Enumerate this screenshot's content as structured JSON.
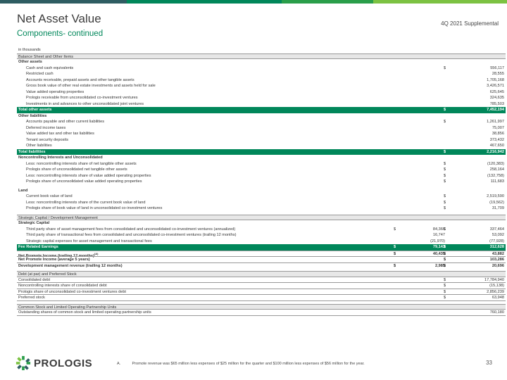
{
  "brand": {
    "colors": [
      "#2f5d62",
      "#00875a",
      "#2a9e4a",
      "#7cc242"
    ],
    "accent": "#00875a",
    "name": "PROLOGIS"
  },
  "header": {
    "title": "Net Asset Value",
    "subtitle": "Components- continued",
    "report": "4Q 2021 Supplemental"
  },
  "rows": [
    {
      "type": "plain",
      "label": "in thousands"
    },
    {
      "type": "header",
      "label": "Balance Sheet and Other Items"
    },
    {
      "type": "group",
      "label": "Other assets"
    },
    {
      "label": "Cash and cash equivalents",
      "c2d": "$",
      "c2": "556,117"
    },
    {
      "label": "Restricted cash",
      "c2": "28,555"
    },
    {
      "label": "Accounts receivable, prepaid assets and other tangible assets",
      "c2": "1,705,168"
    },
    {
      "label": "Gross book value of other real estate investments and assets held for sale",
      "c2": "3,426,571"
    },
    {
      "label": "Value added operating properties",
      "c2": "625,645"
    },
    {
      "label": "Prologis receivable from unconsolidated co-investment ventures",
      "c2": "324,635"
    },
    {
      "label": "Investments in and advances to other unconsolidated joint ventures",
      "c2": "785,503"
    },
    {
      "type": "total",
      "label": "Total other assets",
      "c2d": "$",
      "c2": "7,452,194"
    },
    {
      "type": "group",
      "label": "Other liabilities"
    },
    {
      "label": "Accounts payable and other current liabilities",
      "c2d": "$",
      "c2": "1,261,997"
    },
    {
      "label": "Deferred income taxes",
      "c2": "75,007"
    },
    {
      "label": "Value added tax and other tax liabilities",
      "c2": "38,856"
    },
    {
      "label": "Tenant security deposits",
      "c2": "373,432"
    },
    {
      "label": "Other liabilities",
      "c2": "467,650"
    },
    {
      "type": "total",
      "label": "Total liabilities",
      "c2d": "$",
      "c2": "2,216,942"
    },
    {
      "type": "group",
      "label": "Noncontrolling Interests and Unconsolidated"
    },
    {
      "label": "Less: noncontrolling interests share of net tangible other assets",
      "c2d": "$",
      "c2": "(120,383)"
    },
    {
      "label": "Prologis share of unconsolidated net tangible other assets",
      "c2d": "$",
      "c2": "258,164"
    },
    {
      "label": "Less: noncontrolling interests share of value added operating properties",
      "c2d": "$",
      "c2": "(132,758)"
    },
    {
      "label": "Prologis share of unconsolidated value added operating properties",
      "c2d": "$",
      "c2": "111,683"
    },
    {
      "type": "spacer"
    },
    {
      "type": "group",
      "label": "Land"
    },
    {
      "label": "Current book value of land",
      "c2d": "$",
      "c2": "2,519,590"
    },
    {
      "label": "Less: noncontrolling interests share of the current book value of land",
      "c2d": "$",
      "c2": "(19,562)"
    },
    {
      "label": "Prologis share of book value of land in unconsolidated co-investment ventures",
      "c2d": "$",
      "c2": "31,709"
    },
    {
      "type": "spacer"
    },
    {
      "type": "header",
      "label": "Strategic Capital / Development Management"
    },
    {
      "type": "group",
      "label": "Strategic Capital"
    },
    {
      "label": "Third party share of asset management fees from consolidated and unconsolidated co-investment ventures (annualized)",
      "c1d": "$",
      "c1": "84,366",
      "c2d": "$",
      "c2": "337,464"
    },
    {
      "label": "Third party share of transactional fees from consolidated and unconsolidated co-investment ventures (trailing 12 months)",
      "c1": "16,747",
      "c2": "53,092"
    },
    {
      "label": "Strategic capital expenses for asset management and transactional fees",
      "c1": "(21,970)",
      "c2": "(77,928)"
    },
    {
      "type": "total",
      "label": "Fee Related Earnings",
      "c1d": "$",
      "c1": "79,143",
      "c2d": "$",
      "c2": "312,628"
    },
    {
      "type": "bold",
      "label": "Net Promote Income (trailing 12 months)",
      "sup": "(A)",
      "c1d": "$",
      "c1": "40,435",
      "c2d": "$",
      "c2": "43,882"
    },
    {
      "type": "bold",
      "label": "Net Promote Income (average 5 years)",
      "c2d": "$",
      "c2": "103,286"
    },
    {
      "type": "bold",
      "label": "Development management revenue (trailing 12 months)",
      "c1d": "$",
      "c1": "2,985",
      "c2d": "$",
      "c2": "20,696"
    },
    {
      "type": "spacer"
    },
    {
      "type": "header",
      "label": "Debt (at par) and Preferred Stock"
    },
    {
      "type": "plain",
      "label": "Consolidated debt",
      "c2d": "$",
      "c2": "17,784,940"
    },
    {
      "type": "plain",
      "label": "Noncontrolling interests share of consolidated debt",
      "c2d": "$",
      "c2": "(15,138)"
    },
    {
      "type": "plain",
      "label": "Prologis share of unconsolidated co-investment ventures debt",
      "c2d": "$",
      "c2": "2,856,239"
    },
    {
      "type": "plain",
      "label": "Preferred stock",
      "c2d": "$",
      "c2": "63,948"
    },
    {
      "type": "spacer"
    },
    {
      "type": "header",
      "label": "Common Stock and Limited Operating Partnership Units"
    },
    {
      "type": "plain",
      "label": "Outstanding shares of common stock and limited operating partnership units",
      "c2": "760,180"
    }
  ],
  "footer": {
    "footnote_mark": "A.",
    "footnote_text": "Promote revenue was $65 million less expenses of $25 million for the quarter and $100 million less expenses of $56 million for the year.",
    "page_number": "33"
  }
}
